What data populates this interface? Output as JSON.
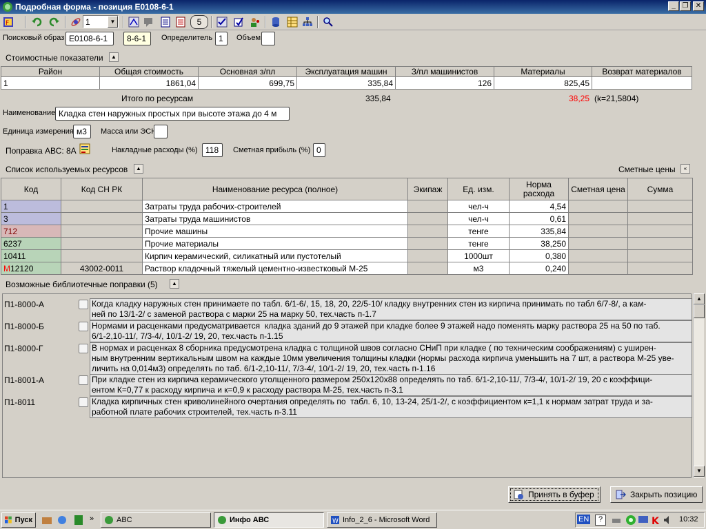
{
  "window": {
    "title": "Подробная форма - позиция Е0108-6-1"
  },
  "toolbar": {
    "combo_value": "1",
    "icons": [
      "form-icon",
      "undo-icon",
      "redo-icon",
      "satellite-icon",
      "layout-icon",
      "chat-icon",
      "page-icon",
      "document-icon",
      "circle-5-icon",
      "checklist-icon",
      "stamp-icon",
      "users-icon",
      "database-icon",
      "table-icon",
      "grid-icon",
      "magnify-icon"
    ],
    "circle_label": "5"
  },
  "search": {
    "label": "Поисковый образ",
    "value": "Е0108-6-1",
    "code": "8-6-1",
    "determinant_label": "Определитель",
    "determinant_value": "1",
    "volume_label": "Объем",
    "volume_value": ""
  },
  "cost": {
    "section_title": "Стоимостные показатели",
    "headers": [
      "Район",
      "Общая стоимость",
      "Основная з/пл",
      "Эксплуатация машин",
      "З/пл машинистов",
      "Материалы",
      "Возврат материалов"
    ],
    "row": [
      "1",
      "1861,04",
      "699,75",
      "335,84",
      "126",
      "825,45",
      ""
    ],
    "total_label": "Итого по ресурсам",
    "total_machines": "335,84",
    "total_materials": "38,25",
    "total_coef": "(k=21,5804)"
  },
  "details": {
    "name_label": "Наименование",
    "name_value": "Кладка стен наружных простых при высоте этажа до 4 м",
    "unit_label": "Единица измерения",
    "unit_value": "м3",
    "mass_label": "Масса или ЭСН",
    "mass_value": "",
    "correction_label": "Поправка АВС: 8А",
    "overhead_label": "Накладные расходы (%)",
    "overhead_value": "118",
    "profit_label": "Сметная прибыль (%)",
    "profit_value": "0"
  },
  "resources": {
    "section_title": "Список используемых ресурсов",
    "prices_label": "Сметные цены",
    "headers": [
      "Код",
      "Код СН РК",
      "Наименование ресурса (полное)",
      "Экипаж",
      "Ед. изм.",
      "Норма расхода",
      "Сметная цена",
      "Сумма"
    ],
    "rows": [
      {
        "code": "1",
        "code_prefix": "",
        "sn": "",
        "name": "Затраты труда рабочих-строителей",
        "crew": "",
        "unit": "чел-ч",
        "norm": "4,54",
        "price": "",
        "sum": "",
        "color": "blue"
      },
      {
        "code": "3",
        "code_prefix": "",
        "sn": "",
        "name": "Затраты труда машинистов",
        "crew": "",
        "unit": "чел-ч",
        "norm": "0,61",
        "price": "",
        "sum": "",
        "color": "blue"
      },
      {
        "code": "712",
        "code_prefix": "",
        "sn": "",
        "name": "Прочие машины",
        "crew": "",
        "unit": "тенге",
        "norm": "335,84",
        "price": "",
        "sum": "",
        "color": "pink"
      },
      {
        "code": "6237",
        "code_prefix": "",
        "sn": "",
        "name": "Прочие материалы",
        "crew": "",
        "unit": "тенге",
        "norm": "38,250",
        "price": "",
        "sum": "",
        "color": "green"
      },
      {
        "code": "10411",
        "code_prefix": "",
        "sn": "",
        "name": "Кирпич керамический, силикатный или пустотелый",
        "crew": "",
        "unit": "1000шт",
        "norm": "0,380",
        "price": "",
        "sum": "",
        "color": "green"
      },
      {
        "code": "12120",
        "code_prefix": "М",
        "sn": "43002-0011",
        "name": "Раствор кладочный тяжелый цементно-известковый М-25",
        "crew": "",
        "unit": "м3",
        "norm": "0,240",
        "price": "",
        "sum": "",
        "color": "green"
      }
    ]
  },
  "library": {
    "section_title": "Возможные библиотечные поправки (5)",
    "items": [
      {
        "code": "П1-8000-А",
        "text": "Когда кладку наружных стен принимаете по табл. 6/1-6/, 15, 18, 20, 22/5-10/ кладку внутренних стен из кирпича принимать по табл 6/7-8/, а кам-\nней по 13/1-2/ с заменой раствора с марки 25 на марку 50, тех.часть п-1.7"
      },
      {
        "code": "П1-8000-Б",
        "text": "Нормами и расценками предусматривается  кладка зданий до 9 этажей при кладке более 9 этажей надо поменять марку раствора 25 на 50 по таб.\n6/1-2,10-11/, 7/3-4/, 10/1-2/ 19, 20, тех.часть п-1.15"
      },
      {
        "code": "П1-8000-Г",
        "text": "В нормах и расценках 8 сборника предусмотрена кладка с толщиной швов согласно СНиП при кладке ( по техническим соображениям) с уширен-\nным внутренним вертикальным швом на каждые 10мм увеличения толщины кладки (нормы расхода кирпича уменьшить на 7 шт, а раствора М-25 уве-\nличить на 0,014м3) определять по таб. 6/1-2,10-11/, 7/3-4/, 10/1-2/ 19, 20, тех.часть п-1.16"
      },
      {
        "code": "П1-8001-А",
        "text": "При кладке стен из кирпича керамического утолщенного размером 250х120х88 определять по таб. 6/1-2,10-11/, 7/3-4/, 10/1-2/ 19, 20 с коэффици-\nентом К=0,77 к расходу кирпича и к=0,9 к расходу раствора М-25, тех.часть п-3.1"
      },
      {
        "code": "П1-8011",
        "text": "Кладка кирпичных стен криволинейного очертания определять по  табл. 6, 10, 13-24, 25/1-2/, с коэффициентом к=1,1 к нормам затрат труда и за-\nработной плате рабочих строителей, тех.часть п-3.11"
      }
    ]
  },
  "buttons": {
    "accept": "Принять в буфер",
    "close": "Закрыть позицию"
  },
  "taskbar": {
    "start": "Пуск",
    "items": [
      "ABC",
      "Инфо АВС",
      "Info_2_6 - Microsoft Word"
    ],
    "lang": "EN",
    "time": "10:32"
  },
  "colors": {
    "titlebar": "#0a246a",
    "red_value": "#ff0000",
    "row_blue": "#bcbcdc",
    "row_pink": "#d8b8b8",
    "row_green": "#b8d4b8"
  }
}
